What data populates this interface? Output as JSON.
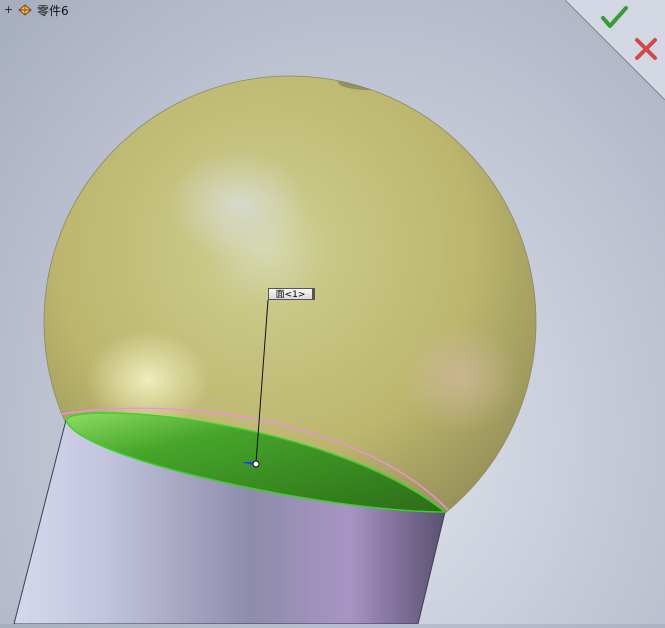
{
  "tree": {
    "expander": "+",
    "part_name": "零件6",
    "part_icon": "part-icon"
  },
  "confirm_corner": {
    "accept_icon": "check-icon",
    "cancel_icon": "close-icon",
    "accept_color": "#3a9a3a",
    "cancel_color": "#d04848"
  },
  "callout": {
    "label": "面<1>"
  },
  "colors": {
    "sphere": "#c8c47c",
    "cylinder": "#b2b4d2",
    "selected_face": "#3d8b1f",
    "selection_edge": "#f08de6",
    "face_outline": "#3bd12a"
  }
}
